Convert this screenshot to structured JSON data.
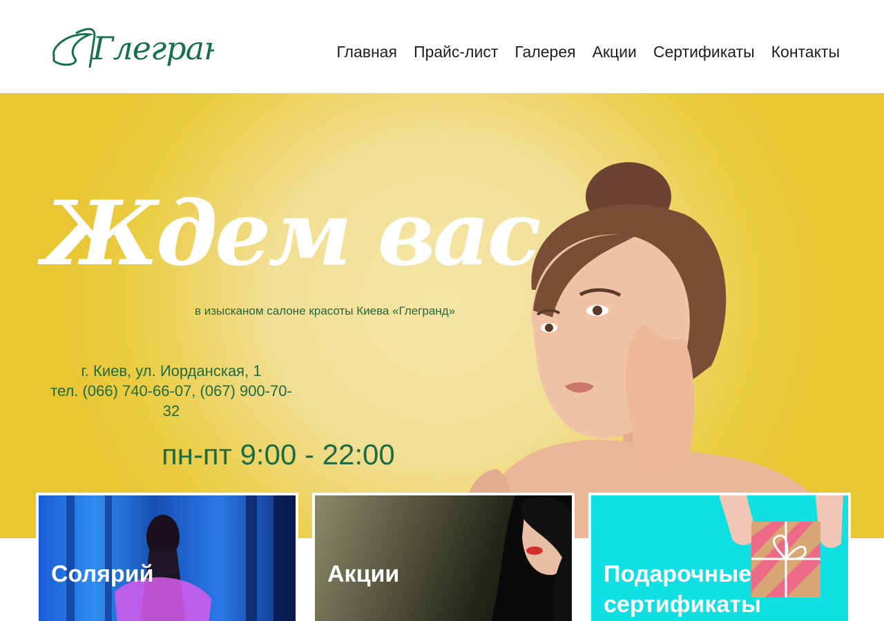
{
  "logo": {
    "text": "Глегранд"
  },
  "nav": {
    "items": [
      {
        "label": "Главная"
      },
      {
        "label": "Прайс-лист"
      },
      {
        "label": "Галерея"
      },
      {
        "label": "Акции"
      },
      {
        "label": "Сертификаты"
      },
      {
        "label": "Контакты"
      }
    ]
  },
  "hero": {
    "title": "Ждем вас",
    "subtitle": "в изысканом салоне красоты Киева «Глегранд»",
    "address": "г. Киев, ул. Иорданская, 1",
    "phone": "тел. (066) 740-66-07, (067) 900-70-32",
    "hours": "пн-пт 9:00 - 22:00"
  },
  "cards": [
    {
      "label": "Солярий"
    },
    {
      "label": "Акции"
    },
    {
      "label": "Подарочные сертификаты"
    }
  ],
  "colors": {
    "brand_green": "#1f6a42",
    "hero_yellow": "#e8c532",
    "hero_light": "#f5e6a8",
    "cyan_card": "#10e0e2"
  }
}
